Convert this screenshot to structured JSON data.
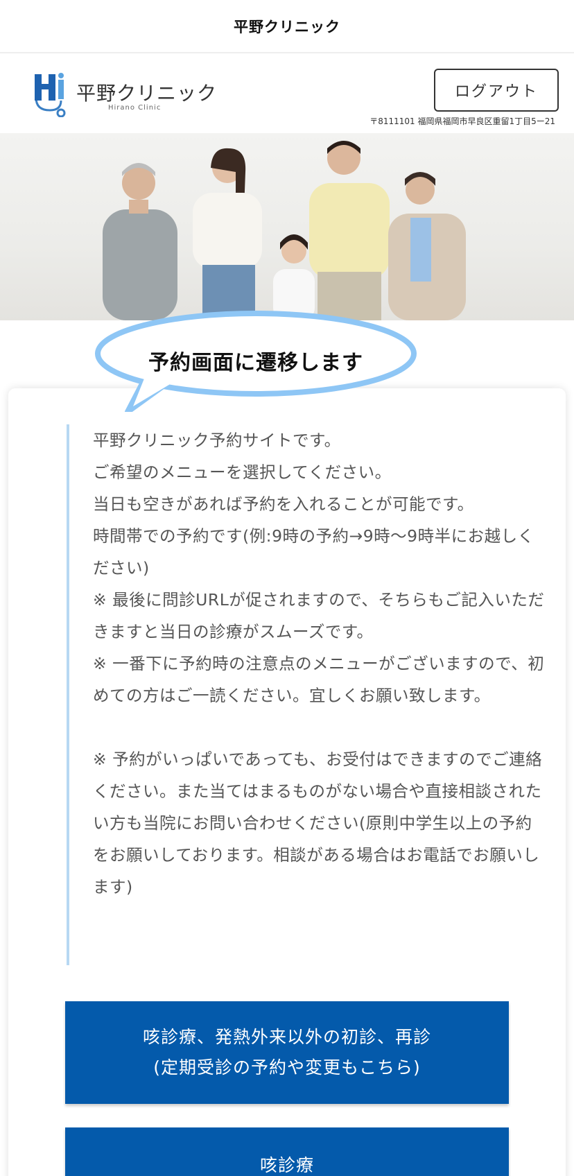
{
  "topbar": {
    "title": "平野クリニック"
  },
  "header": {
    "logo_text": "平野クリニック",
    "logo_sub": "Hirano Clinic",
    "logout_label": "ログアウト",
    "address": "〒8111101 福岡県福岡市早良区重留1丁目5ー21"
  },
  "bubble": {
    "text": "予約画面に遷移します"
  },
  "notice": {
    "text": "平野クリニック予約サイトです。\nご希望のメニューを選択してください。\n当日も空きがあれば予約を入れることが可能です。\n時間帯での予約です(例:9時の予約→9時〜9時半にお越しください)\n※ 最後に問診URLが促されますので、そちらもご記入いただきますと当日の診療がスムーズです。\n※ 一番下に予約時の注意点のメニューがございますので、初めての方はご一読ください。宜しくお願い致します。\n\n※ 予約がいっぱいであっても、お受付はできますのでご連絡ください。また当てはまるものがない場合や直接相談されたい方も当院にお問い合わせください(原則中学生以上の予約をお願いしております。相談がある場合はお電話でお願いします)"
  },
  "menu": {
    "item1_line1": "咳診療、発熱外来以外の初診、再診",
    "item1_line2": "(定期受診の予約や変更もこちら)",
    "item2_label": "咳診療"
  },
  "colors": {
    "primary": "#045aab",
    "bubble_border": "#8ec6f5",
    "notice_border": "#b7d8f3"
  }
}
